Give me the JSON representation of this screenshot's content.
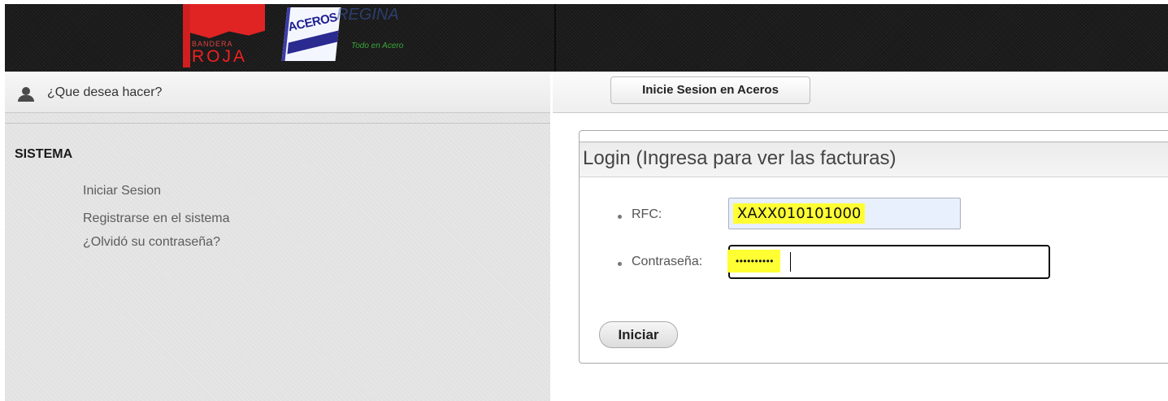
{
  "header": {
    "logo_bandera": {
      "top_text": "BANDERA",
      "bottom_text": "ROJA"
    },
    "logo_aceros": {
      "brand_text": "ACEROS",
      "script_text": "REGINA",
      "tagline": "Todo en Acero"
    },
    "brand_colors": {
      "bandera_red": "#e02424",
      "aceros_blue": "#1e1e90",
      "tagline_green": "#3aa83a"
    }
  },
  "sidebar": {
    "header_icon": "user-icon",
    "header_title": "¿Que desea hacer?",
    "section_title": "SISTEMA",
    "links": [
      {
        "label": "Iniciar Sesion"
      },
      {
        "label": "Registrarse en el sistema"
      },
      {
        "label": "¿Olvidó su contraseña?"
      }
    ]
  },
  "main": {
    "tab_label": "Inicie Sesion en Aceros",
    "login": {
      "title": "Login (Ingresa para ver las facturas)",
      "rfc_label": "RFC:",
      "rfc_value": "XAXX010101000",
      "password_label": "Contraseña:",
      "password_mask": "••••••••••",
      "submit_label": "Iniciar"
    }
  }
}
